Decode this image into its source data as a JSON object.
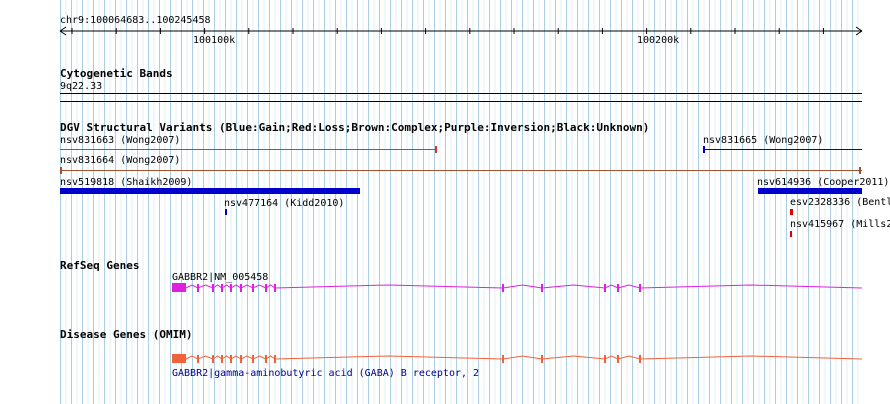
{
  "ruler": {
    "location": "chr9:100064683..100245458",
    "ticks": [
      "100100k",
      "100200k"
    ]
  },
  "tracks": {
    "cytoband": {
      "title": "Cytogenetic Bands",
      "band": "9q22.33"
    },
    "dgv": {
      "title": "DGV Structural Variants (Blue:Gain;Red:Loss;Brown:Complex;Purple:Inversion;Black:Unknown)",
      "features": [
        {
          "label": "nsv831663 (Wong2007)",
          "type": "loss"
        },
        {
          "label": "nsv831665 (Wong2007)",
          "type": "gain"
        },
        {
          "label": "nsv831664 (Wong2007)",
          "type": "complex"
        },
        {
          "label": "nsv519818 (Shaikh2009)",
          "type": "gain"
        },
        {
          "label": "nsv614936 (Cooper2011)",
          "type": "gain"
        },
        {
          "label": "nsv477164 (Kidd2010)",
          "type": "gain"
        },
        {
          "label": "esv2328336 (Bentl",
          "type": "loss"
        },
        {
          "label": "nsv415967 (Mills2",
          "type": "loss"
        }
      ]
    },
    "refseq": {
      "title": "RefSeq Genes",
      "gene_label": "GABBR2|NM_005458"
    },
    "omim": {
      "title": "Disease Genes (OMIM)",
      "gene_label": "GABBR2|gamma-aminobutyric acid (GABA) B receptor, 2"
    }
  },
  "colors": {
    "gain": "#0000cd",
    "loss": "#d23b2b",
    "complex": "#a0522d",
    "refseq": "#e020e0",
    "omim": "#f0623a"
  }
}
